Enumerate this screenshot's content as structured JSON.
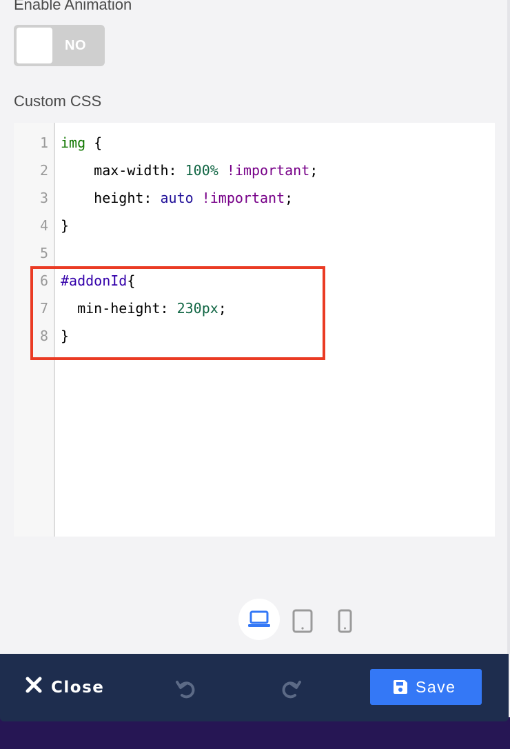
{
  "animation": {
    "label": "Enable Animation",
    "toggle_state": "NO",
    "enabled": false
  },
  "custom_css": {
    "label": "Custom CSS",
    "lines": [
      {
        "num": "1",
        "tokens": [
          {
            "t": "img",
            "c": "tag"
          },
          {
            "t": " {",
            "c": ""
          }
        ]
      },
      {
        "num": "2",
        "tokens": [
          {
            "t": "    max-width: ",
            "c": ""
          },
          {
            "t": "100%",
            "c": "num"
          },
          {
            "t": " ",
            "c": ""
          },
          {
            "t": "!important",
            "c": "kw"
          },
          {
            "t": ";",
            "c": ""
          }
        ]
      },
      {
        "num": "3",
        "tokens": [
          {
            "t": "    height: ",
            "c": ""
          },
          {
            "t": "auto",
            "c": "atom"
          },
          {
            "t": " ",
            "c": ""
          },
          {
            "t": "!important",
            "c": "kw"
          },
          {
            "t": ";",
            "c": ""
          }
        ]
      },
      {
        "num": "4",
        "tokens": [
          {
            "t": "}",
            "c": ""
          }
        ]
      },
      {
        "num": "5",
        "tokens": []
      },
      {
        "num": "6",
        "tokens": [
          {
            "t": "#addonId",
            "c": "builtin"
          },
          {
            "t": "{",
            "c": ""
          }
        ]
      },
      {
        "num": "7",
        "tokens": [
          {
            "t": "  min-height: ",
            "c": ""
          },
          {
            "t": "230px",
            "c": "num"
          },
          {
            "t": ";",
            "c": ""
          }
        ]
      },
      {
        "num": "8",
        "tokens": [
          {
            "t": "}",
            "c": ""
          }
        ]
      }
    ]
  },
  "devices": {
    "active": "desktop",
    "items": [
      "desktop",
      "tablet",
      "mobile"
    ]
  },
  "footer": {
    "close_label": "Close",
    "save_label": "Save"
  },
  "colors": {
    "accent": "#3478f6",
    "footer_bg": "#1e2d4e",
    "highlight_border": "#ea3b24"
  }
}
